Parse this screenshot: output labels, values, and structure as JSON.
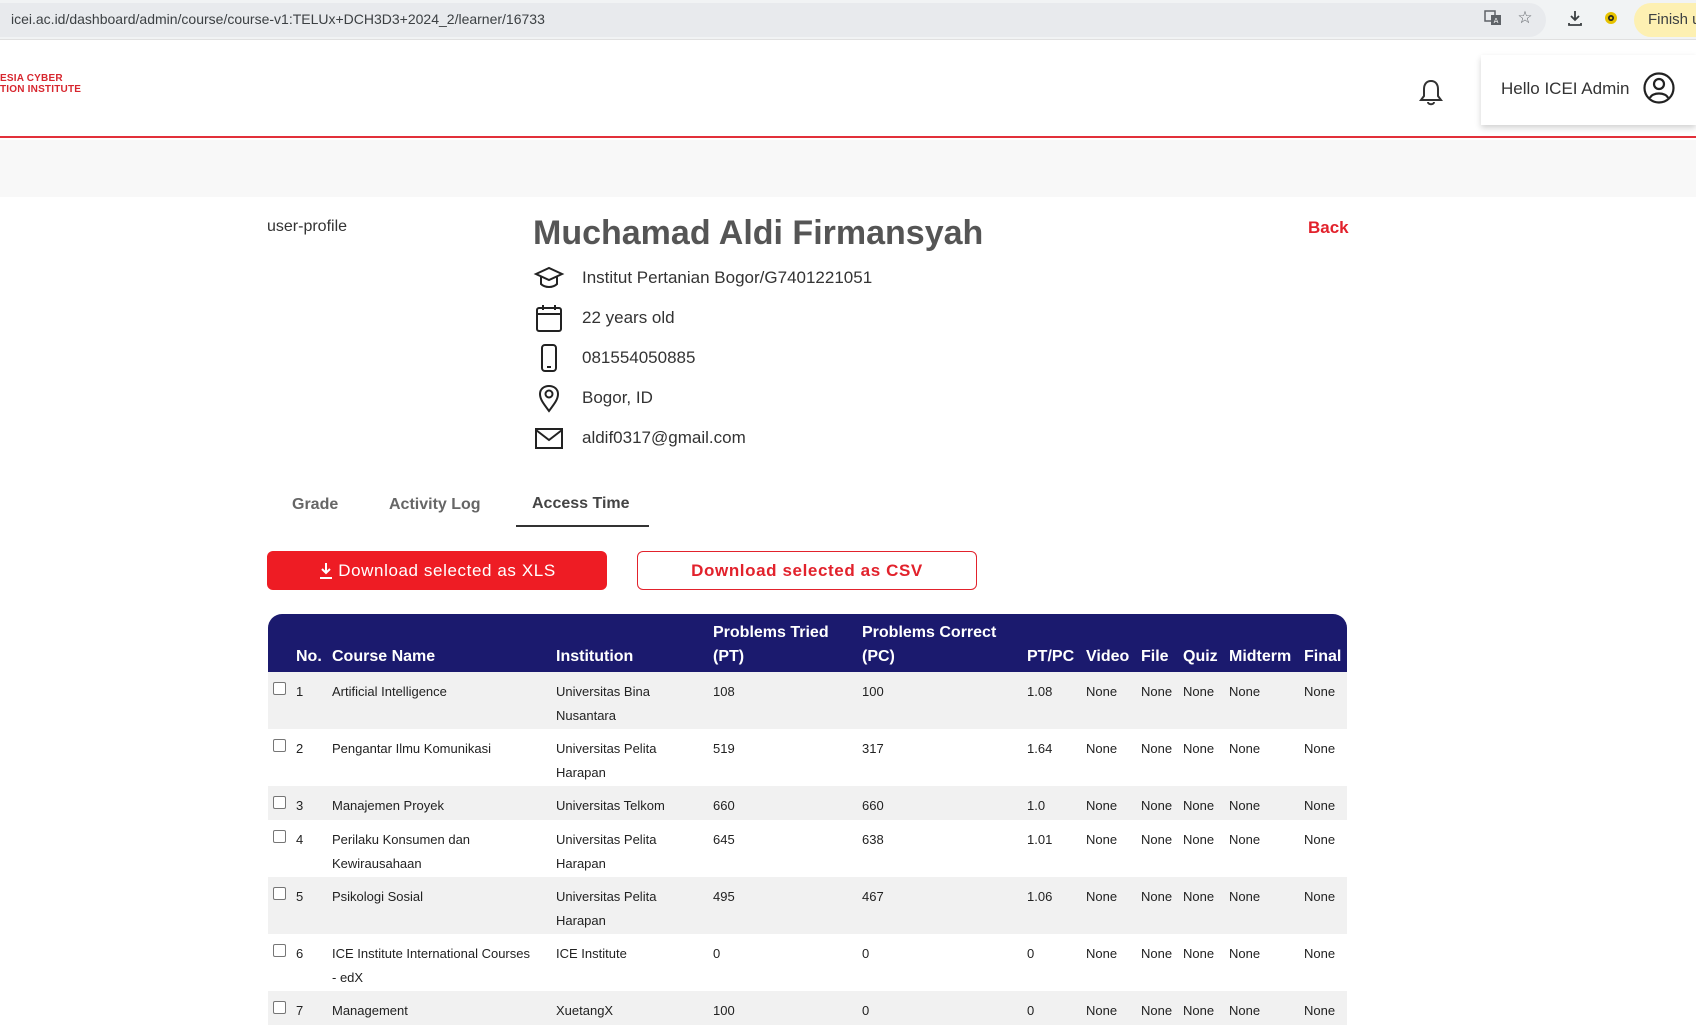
{
  "browser": {
    "url": "icei.ac.id/dashboard/admin/course/course-v1:TELUx+DCH3D3+2024_2/learner/16733",
    "finish_label": "Finish u"
  },
  "header": {
    "logo_line1": "ESIA CYBER",
    "logo_line2": "TION INSTITUTE",
    "greeting": "Hello ICEI Admin"
  },
  "profile": {
    "image_alt": "user-profile",
    "name": "Muchamad Aldi Firmansyah",
    "back_label": "Back",
    "institution": "Institut Pertanian Bogor/G7401221051",
    "age": "22 years old",
    "phone": "081554050885",
    "location": "Bogor, ID",
    "email": "aldif0317@gmail.com"
  },
  "tabs": [
    {
      "label": "Grade"
    },
    {
      "label": "Activity Log"
    },
    {
      "label": "Access Time"
    }
  ],
  "actions": {
    "xls_label": "Download selected as XLS",
    "csv_label": "Download selected as CSV"
  },
  "table": {
    "headers": {
      "no": "No.",
      "course": "Course Name",
      "institution": "Institution",
      "pt_line1": "Problems Tried",
      "pt_line2": "(PT)",
      "pc_line1": "Problems Correct",
      "pc_line2": "(PC)",
      "ptpc": "PT/PC",
      "video": "Video",
      "file": "File",
      "quiz": "Quiz",
      "midterm": "Midterm",
      "final": "Final"
    },
    "rows": [
      {
        "no": "1",
        "course": [
          "Artificial Intelligence"
        ],
        "institution": [
          "Universitas Bina",
          "Nusantara"
        ],
        "pt": "108",
        "pc": "100",
        "ptpc": "1.08",
        "video": "None",
        "file": "None",
        "quiz": "None",
        "midterm": "None",
        "final": "None"
      },
      {
        "no": "2",
        "course": [
          "Pengantar Ilmu Komunikasi"
        ],
        "institution": [
          "Universitas Pelita",
          "Harapan"
        ],
        "pt": "519",
        "pc": "317",
        "ptpc": "1.64",
        "video": "None",
        "file": "None",
        "quiz": "None",
        "midterm": "None",
        "final": "None"
      },
      {
        "no": "3",
        "course": [
          "Manajemen Proyek"
        ],
        "institution": [
          "Universitas Telkom"
        ],
        "pt": "660",
        "pc": "660",
        "ptpc": "1.0",
        "video": "None",
        "file": "None",
        "quiz": "None",
        "midterm": "None",
        "final": "None"
      },
      {
        "no": "4",
        "course": [
          "Perilaku Konsumen dan",
          "Kewirausahaan"
        ],
        "institution": [
          "Universitas Pelita",
          "Harapan"
        ],
        "pt": "645",
        "pc": "638",
        "ptpc": "1.01",
        "video": "None",
        "file": "None",
        "quiz": "None",
        "midterm": "None",
        "final": "None"
      },
      {
        "no": "5",
        "course": [
          "Psikologi Sosial"
        ],
        "institution": [
          "Universitas Pelita",
          "Harapan"
        ],
        "pt": "495",
        "pc": "467",
        "ptpc": "1.06",
        "video": "None",
        "file": "None",
        "quiz": "None",
        "midterm": "None",
        "final": "None"
      },
      {
        "no": "6",
        "course": [
          "ICE Institute International Courses",
          "- edX"
        ],
        "institution": [
          "ICE Institute"
        ],
        "pt": "0",
        "pc": "0",
        "ptpc": "0",
        "video": "None",
        "file": "None",
        "quiz": "None",
        "midterm": "None",
        "final": "None"
      },
      {
        "no": "7",
        "course": [
          "Management"
        ],
        "institution": [
          "XuetangX"
        ],
        "pt": "100",
        "pc": "0",
        "ptpc": "0",
        "video": "None",
        "file": "None",
        "quiz": "None",
        "midterm": "None",
        "final": "None"
      }
    ]
  },
  "colors": {
    "brand_red": "#ee1c24",
    "table_header": "#1b1a6e"
  }
}
